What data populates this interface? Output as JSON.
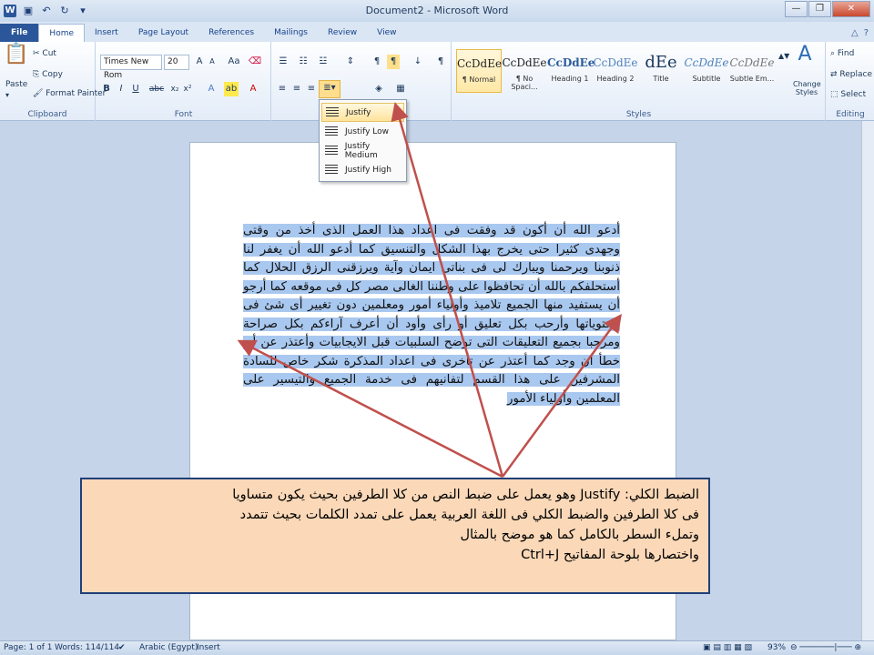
{
  "window": {
    "title": "Document2 - Microsoft Word",
    "controls": [
      "—",
      "❐",
      "✕"
    ]
  },
  "tabs": [
    "File",
    "Home",
    "Insert",
    "Page Layout",
    "References",
    "Mailings",
    "Review",
    "View"
  ],
  "active_tab": "Home",
  "ribbon": {
    "clipboard": {
      "paste": "Paste",
      "cut": "Cut",
      "copy": "Copy",
      "format_painter": "Format Painter",
      "label": "Clipboard"
    },
    "font": {
      "font_name": "Times New Rom",
      "font_size": "20",
      "label": "Font"
    },
    "styles": {
      "items": [
        {
          "sample": "CcDdEe",
          "name": "¶ Normal"
        },
        {
          "sample": "CcDdEe",
          "name": "¶ No Spaci..."
        },
        {
          "sample": "CcDdEe",
          "name": "Heading 1"
        },
        {
          "sample": "CcDdEe",
          "name": "Heading 2"
        },
        {
          "sample": "dEe",
          "name": "Title"
        },
        {
          "sample": "CcDdEe",
          "name": "Subtitle"
        },
        {
          "sample": "CcDdEe",
          "name": "Subtle Em..."
        }
      ],
      "change_styles": "Change Styles",
      "label": "Styles"
    },
    "editing": {
      "find": "Find",
      "replace": "Replace",
      "select": "Select",
      "label": "Editing"
    }
  },
  "justify_menu": [
    "Justify",
    "Justify Low",
    "Justify Medium",
    "Justify High"
  ],
  "document_text": "أدعو الله أن أكون قد وفقت فى اعداد هذا العمل الذى أخذ من وقتى وجهدى كثيرا حتى يخرج بهذا الشكل والتنسيق كما أدعو الله أن يغفر لنا ذنوبنا ويرحمنا ويبارك لى فى بناتى ايمان وآية ويرزقنى الرزق الحلال كما أستحلفكم بالله أن تحافظوا على وطننا الغالى مصر كل فى موقعه كما أرجو أن يستفيد منها الجميع تلاميذ وأولياء أمور ومعلمين دون تغيير أى شئ فى محتوياتها وأرحب بكل تعليق أو رأى وأود أن أعرف آراءكم بكل صراحة ومرحبا بجميع التعليقات التى توضح السلبيات قبل الايجابيات وأعتذر عن أى خطأ ان وجد كما أعتذر عن تأخرى فى اعداد المذكرة شكر خاص للسادة المشرفين على هذا القسم لتفانيهم فى خدمة الجميع والتيسير على المعلمين وأولياء الأمور",
  "callout": [
    "الضبط الكلي: Justify وهو يعمل على ضبط النص من كلا الطرفين بحيث يكون متساويا",
    "فى كلا الطرفين والضبط الكلي فى اللغة العربية يعمل على تمدد الكلمات بحيث تتمدد",
    "وتملء السطر بالكامل كما هو موضح بالمثال",
    "واختصارها بلوحة المفاتيح Ctrl+J"
  ],
  "status": {
    "page": "Page: 1 of 1",
    "words": "Words: 114/114",
    "language": "Arabic (Egypt)",
    "mode": "Insert",
    "zoom": "93%"
  },
  "colors": {
    "accent": "#2b579a",
    "selection": "#a9c8ef",
    "callout_bg": "#fbd9b8",
    "arrow": "#c0504d"
  }
}
